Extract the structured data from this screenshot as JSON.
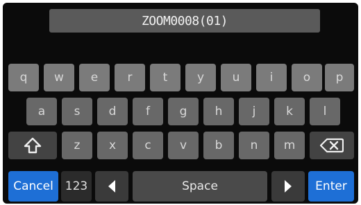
{
  "name_field": {
    "value": "ZOOM0008(01)"
  },
  "keyboard": {
    "row1": [
      "q",
      "w",
      "e",
      "r",
      "t",
      "y",
      "u",
      "i",
      "o",
      "p"
    ],
    "row2": [
      "a",
      "s",
      "d",
      "f",
      "g",
      "h",
      "j",
      "k",
      "l"
    ],
    "row3": [
      "z",
      "x",
      "c",
      "v",
      "b",
      "n",
      "m"
    ],
    "cancel_label": "Cancel",
    "numbers_label": "123",
    "space_label": "Space",
    "enter_label": "Enter"
  },
  "icons": {
    "shift": "shift-arrow-icon",
    "backspace": "backspace-icon",
    "left": "left-arrow-icon",
    "right": "right-arrow-icon"
  },
  "colors": {
    "background": "#0b0b0b",
    "key": "#7b7b7b",
    "function_key": "#434343",
    "accent": "#1e6fd6"
  }
}
